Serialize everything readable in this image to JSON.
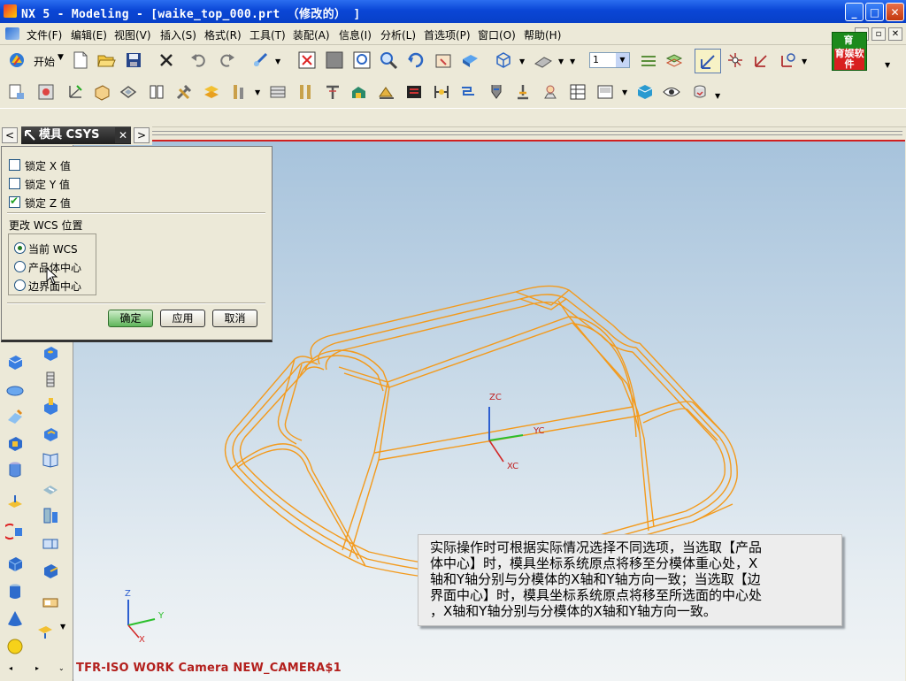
{
  "window": {
    "title": "NX 5 - Modeling - [waike_top_000.prt （修改的） ]",
    "min_label": "_",
    "max_label": "□",
    "close_label": "✕"
  },
  "menubar": {
    "items": [
      "文件(F)",
      "编辑(E)",
      "视图(V)",
      "插入(S)",
      "格式(R)",
      "工具(T)",
      "装配(A)",
      "信息(I)",
      "分析(L)",
      "首选项(P)",
      "窗口(O)",
      "帮助(H)"
    ]
  },
  "brand": {
    "top": "育",
    "label": "育娱软件"
  },
  "toolbar": {
    "start_label": "开始",
    "layer_value": "1"
  },
  "dialog": {
    "title": "模具 CSYS",
    "nav_prev": "<",
    "nav_next": ">",
    "close": "✕",
    "lock_x": {
      "label": "锁定 X 值",
      "checked": false
    },
    "lock_y": {
      "label": "锁定 Y 值",
      "checked": false
    },
    "lock_z": {
      "label": "锁定 Z 值",
      "checked": true
    },
    "section_label": "更改 WCS 位置",
    "options": [
      {
        "label": "当前 WCS",
        "selected": true
      },
      {
        "label": "产品体中心",
        "selected": false
      },
      {
        "label": "边界面中心",
        "selected": false
      }
    ],
    "ok": "确定",
    "apply": "应用",
    "cancel": "取消"
  },
  "viewport": {
    "wcs_labels": {
      "zc": "ZC",
      "yc": "YC",
      "xc": "XC"
    },
    "triad_labels": {
      "z": "Z",
      "y": "Y",
      "x": "X"
    },
    "status": "TFR-ISO WORK Camera NEW_CAMERA$1",
    "model_color": "#f39a1c"
  },
  "note": {
    "lines": [
      "实际操作时可根据实际情况选择不同选项，当选取【产品",
      "体中心】时，模具坐标系统原点将移至分模体重心处，X",
      "轴和Y轴分别与分模体的X轴和Y轴方向一致；当选取【边",
      "界面中心】时，模具坐标系统原点将移至所选面的中心处",
      "，X轴和Y轴分别与分模体的X轴和Y轴方向一致。"
    ]
  }
}
